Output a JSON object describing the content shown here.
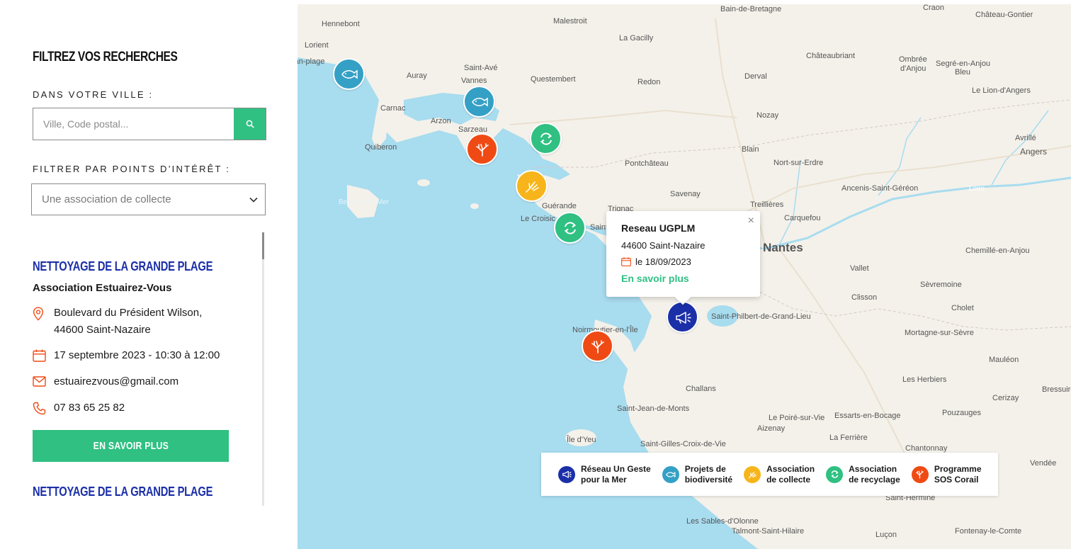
{
  "sidebar": {
    "title": "FILTREZ VOS RECHERCHES",
    "city_label": "DANS VOTRE VILLE :",
    "city_placeholder": "Ville, Code postal...",
    "poi_label": "FILTRER PAR POINTS D’INTÉRÊT :",
    "poi_selected": "Une association de collecte",
    "results": [
      {
        "title": "NETTOYAGE DE LA GRANDE PLAGE",
        "organizer": "Association Estuairez-Vous",
        "address_line1": "Boulevard du Président Wilson,",
        "address_line2": "44600 Saint-Nazaire",
        "date": "17 septembre 2023 - 10:30 à 12:00",
        "email": "estuairezvous@gmail.com",
        "phone": "07 83 65 25 82",
        "button": "EN SAVOIR PLUS"
      },
      {
        "title": "NETTOYAGE DE LA GRANDE PLAGE"
      }
    ]
  },
  "map": {
    "places": [
      "Hennebont",
      "Malestroit",
      "Bain-de-Bretagne",
      "Craon",
      "Château-Gontier",
      "Lorient",
      "morbihan-plage",
      "La Gacilly",
      "Châteaubriant",
      "Ombrée",
      "d'Anjou",
      "Segré-en-Anjou",
      "Bleu",
      "Saint-Avé",
      "Vannes",
      "Auray",
      "Questembert",
      "Redon",
      "Derval",
      "Le Lion-d'Angers",
      "Carnac",
      "Nozay",
      "Arzon",
      "Sarzeau",
      "Avrillé",
      "Angers",
      "Quiberon",
      "Blain",
      "Pontchâteau",
      "Nort-sur-Erdre",
      "Savenay",
      "Treillières",
      "Ancenis-Saint-Géréon",
      "Guérande",
      "Trignac",
      "Carquefou",
      "Le Croisic",
      "Saint",
      "Nantes",
      "Chemillé-en-Anjou",
      "Vallet",
      "Sèvremoine",
      "Clisson",
      "Saint-Philbert-de-Grand-Lieu",
      "Cholet",
      "Noirmoutier-en-l'Île",
      "Mortagne-sur-Sèvre",
      "Mauléon",
      "Challans",
      "Les Herbiers",
      "Bressuire",
      "Saint-Jean-de-Monts",
      "Cerizay",
      "Le Poiré-sur-Vie",
      "Essarts-en-Bocage",
      "Pouzauges",
      "Aizenay",
      "La Ferrière",
      "Île d'Yeu",
      "Saint-Gilles-Croix-de-Vie",
      "Chantonnay",
      "Saint-Hermine",
      "Les Sables-d'Olonne",
      "Talmont-Saint-Hilaire",
      "Luçon",
      "Fontenay-le-Comte",
      "Belle-Île-en-Mer",
      "Loire",
      "Vendée"
    ],
    "popup": {
      "title": "Reseau UGPLM",
      "city": "44600 Saint-Nazaire",
      "date": "le 18/09/2023",
      "link": "En savoir plus",
      "close": "×"
    },
    "legend": [
      {
        "label": "Réseau Un Geste\npour la Mer",
        "color": "#1b2fa8",
        "icon": "megaphone-icon"
      },
      {
        "label": "Projets de\nbiodiversité",
        "color": "#35a0c5",
        "icon": "fish-icon"
      },
      {
        "label": "Association\nde collecte",
        "color": "#f7b51b",
        "icon": "hand-icon"
      },
      {
        "label": "Association\nde recyclage",
        "color": "#2fc082",
        "icon": "recycle-icon"
      },
      {
        "label": "Programme\nSOS Corail",
        "color": "#f04a14",
        "icon": "coral-icon"
      }
    ]
  },
  "colors": {
    "accent": "#2fc082",
    "title_blue": "#1b2fa8",
    "orange": "#f04a14",
    "sea": "#a8dcef",
    "land": "#f4f1ea"
  }
}
